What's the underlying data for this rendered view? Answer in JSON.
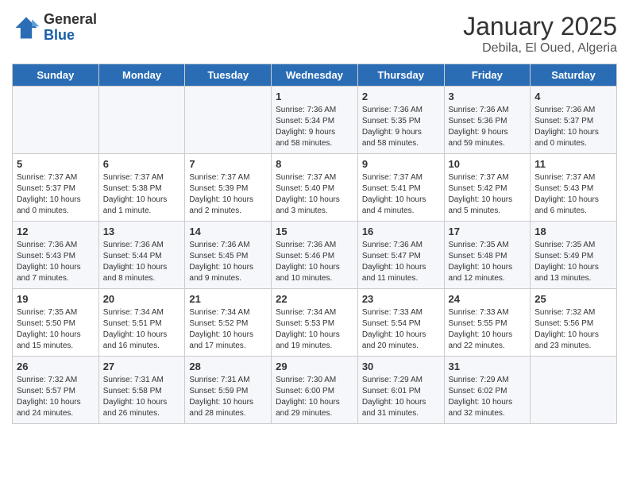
{
  "header": {
    "logo_line1": "General",
    "logo_line2": "Blue",
    "title": "January 2025",
    "subtitle": "Debila, El Oued, Algeria"
  },
  "days": [
    "Sunday",
    "Monday",
    "Tuesday",
    "Wednesday",
    "Thursday",
    "Friday",
    "Saturday"
  ],
  "weeks": [
    [
      {
        "date": "",
        "info": ""
      },
      {
        "date": "",
        "info": ""
      },
      {
        "date": "",
        "info": ""
      },
      {
        "date": "1",
        "info": "Sunrise: 7:36 AM\nSunset: 5:34 PM\nDaylight: 9 hours\nand 58 minutes."
      },
      {
        "date": "2",
        "info": "Sunrise: 7:36 AM\nSunset: 5:35 PM\nDaylight: 9 hours\nand 58 minutes."
      },
      {
        "date": "3",
        "info": "Sunrise: 7:36 AM\nSunset: 5:36 PM\nDaylight: 9 hours\nand 59 minutes."
      },
      {
        "date": "4",
        "info": "Sunrise: 7:36 AM\nSunset: 5:37 PM\nDaylight: 10 hours\nand 0 minutes."
      }
    ],
    [
      {
        "date": "5",
        "info": "Sunrise: 7:37 AM\nSunset: 5:37 PM\nDaylight: 10 hours\nand 0 minutes."
      },
      {
        "date": "6",
        "info": "Sunrise: 7:37 AM\nSunset: 5:38 PM\nDaylight: 10 hours\nand 1 minute."
      },
      {
        "date": "7",
        "info": "Sunrise: 7:37 AM\nSunset: 5:39 PM\nDaylight: 10 hours\nand 2 minutes."
      },
      {
        "date": "8",
        "info": "Sunrise: 7:37 AM\nSunset: 5:40 PM\nDaylight: 10 hours\nand 3 minutes."
      },
      {
        "date": "9",
        "info": "Sunrise: 7:37 AM\nSunset: 5:41 PM\nDaylight: 10 hours\nand 4 minutes."
      },
      {
        "date": "10",
        "info": "Sunrise: 7:37 AM\nSunset: 5:42 PM\nDaylight: 10 hours\nand 5 minutes."
      },
      {
        "date": "11",
        "info": "Sunrise: 7:37 AM\nSunset: 5:43 PM\nDaylight: 10 hours\nand 6 minutes."
      }
    ],
    [
      {
        "date": "12",
        "info": "Sunrise: 7:36 AM\nSunset: 5:43 PM\nDaylight: 10 hours\nand 7 minutes."
      },
      {
        "date": "13",
        "info": "Sunrise: 7:36 AM\nSunset: 5:44 PM\nDaylight: 10 hours\nand 8 minutes."
      },
      {
        "date": "14",
        "info": "Sunrise: 7:36 AM\nSunset: 5:45 PM\nDaylight: 10 hours\nand 9 minutes."
      },
      {
        "date": "15",
        "info": "Sunrise: 7:36 AM\nSunset: 5:46 PM\nDaylight: 10 hours\nand 10 minutes."
      },
      {
        "date": "16",
        "info": "Sunrise: 7:36 AM\nSunset: 5:47 PM\nDaylight: 10 hours\nand 11 minutes."
      },
      {
        "date": "17",
        "info": "Sunrise: 7:35 AM\nSunset: 5:48 PM\nDaylight: 10 hours\nand 12 minutes."
      },
      {
        "date": "18",
        "info": "Sunrise: 7:35 AM\nSunset: 5:49 PM\nDaylight: 10 hours\nand 13 minutes."
      }
    ],
    [
      {
        "date": "19",
        "info": "Sunrise: 7:35 AM\nSunset: 5:50 PM\nDaylight: 10 hours\nand 15 minutes."
      },
      {
        "date": "20",
        "info": "Sunrise: 7:34 AM\nSunset: 5:51 PM\nDaylight: 10 hours\nand 16 minutes."
      },
      {
        "date": "21",
        "info": "Sunrise: 7:34 AM\nSunset: 5:52 PM\nDaylight: 10 hours\nand 17 minutes."
      },
      {
        "date": "22",
        "info": "Sunrise: 7:34 AM\nSunset: 5:53 PM\nDaylight: 10 hours\nand 19 minutes."
      },
      {
        "date": "23",
        "info": "Sunrise: 7:33 AM\nSunset: 5:54 PM\nDaylight: 10 hours\nand 20 minutes."
      },
      {
        "date": "24",
        "info": "Sunrise: 7:33 AM\nSunset: 5:55 PM\nDaylight: 10 hours\nand 22 minutes."
      },
      {
        "date": "25",
        "info": "Sunrise: 7:32 AM\nSunset: 5:56 PM\nDaylight: 10 hours\nand 23 minutes."
      }
    ],
    [
      {
        "date": "26",
        "info": "Sunrise: 7:32 AM\nSunset: 5:57 PM\nDaylight: 10 hours\nand 24 minutes."
      },
      {
        "date": "27",
        "info": "Sunrise: 7:31 AM\nSunset: 5:58 PM\nDaylight: 10 hours\nand 26 minutes."
      },
      {
        "date": "28",
        "info": "Sunrise: 7:31 AM\nSunset: 5:59 PM\nDaylight: 10 hours\nand 28 minutes."
      },
      {
        "date": "29",
        "info": "Sunrise: 7:30 AM\nSunset: 6:00 PM\nDaylight: 10 hours\nand 29 minutes."
      },
      {
        "date": "30",
        "info": "Sunrise: 7:29 AM\nSunset: 6:01 PM\nDaylight: 10 hours\nand 31 minutes."
      },
      {
        "date": "31",
        "info": "Sunrise: 7:29 AM\nSunset: 6:02 PM\nDaylight: 10 hours\nand 32 minutes."
      },
      {
        "date": "",
        "info": ""
      }
    ]
  ]
}
